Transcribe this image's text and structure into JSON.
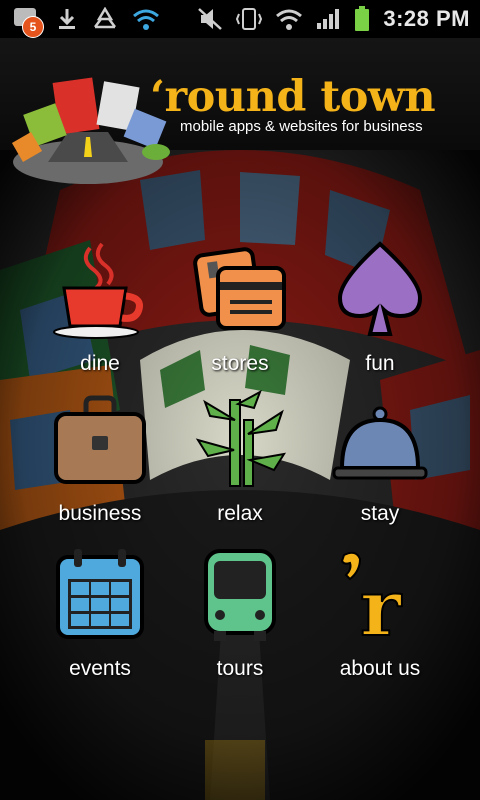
{
  "status_bar": {
    "notification_count": "5",
    "time": "3:28 PM",
    "icons": [
      "notification-badge-icon",
      "download-icon",
      "recycle-icon",
      "wifi-icon",
      "mute-icon",
      "vibrate-icon",
      "wifi-signal-icon",
      "cell-signal-icon",
      "battery-icon"
    ]
  },
  "header": {
    "brand": "‘round town",
    "tagline": "mobile apps & websites for business"
  },
  "menu": {
    "items": [
      {
        "label": "dine",
        "icon": "coffee-cup-icon"
      },
      {
        "label": "stores",
        "icon": "credit-cards-icon"
      },
      {
        "label": "fun",
        "icon": "spade-icon"
      },
      {
        "label": "business",
        "icon": "briefcase-icon"
      },
      {
        "label": "relax",
        "icon": "bamboo-icon"
      },
      {
        "label": "stay",
        "icon": "service-bell-icon"
      },
      {
        "label": "events",
        "icon": "calendar-icon"
      },
      {
        "label": "tours",
        "icon": "bus-icon"
      },
      {
        "label": "about us",
        "icon": "round-town-logo-icon"
      }
    ]
  },
  "colors": {
    "brand": "#f5b31a",
    "coffee": "#e83a2c",
    "cards": "#f0904a",
    "spade": "#9b6fc4",
    "briefcase": "#a77a55",
    "bamboo": "#5fb04a",
    "bell": "#6d87b5",
    "calendar": "#4fa9dc",
    "bus": "#5ec48b"
  }
}
